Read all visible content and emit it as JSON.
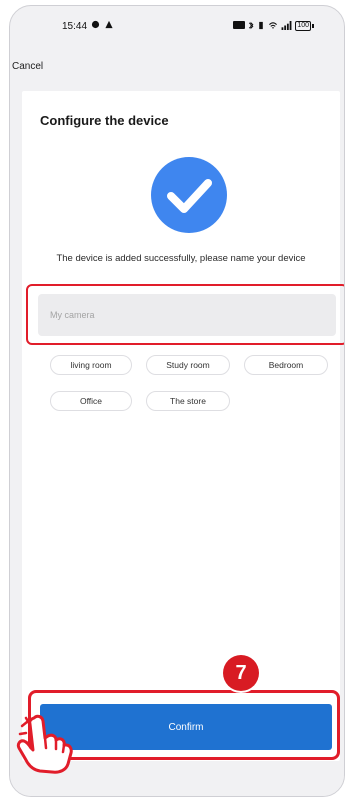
{
  "status_bar": {
    "time": "15:44",
    "battery_text": "100"
  },
  "nav": {
    "cancel_label": "Cancel"
  },
  "card": {
    "title": "Configure the device",
    "success_message": "The device is added successfully, please name your device",
    "name_input": {
      "placeholder": "My camera",
      "value": ""
    },
    "suggestions": [
      "living room",
      "Study room",
      "Bedroom",
      "Office",
      "The store"
    ]
  },
  "actions": {
    "confirm_label": "Confirm"
  },
  "annotation": {
    "step_number": "7"
  },
  "colors": {
    "primary": "#1f72d1",
    "check_circle": "#3f86ef",
    "highlight": "#e11d2a"
  }
}
